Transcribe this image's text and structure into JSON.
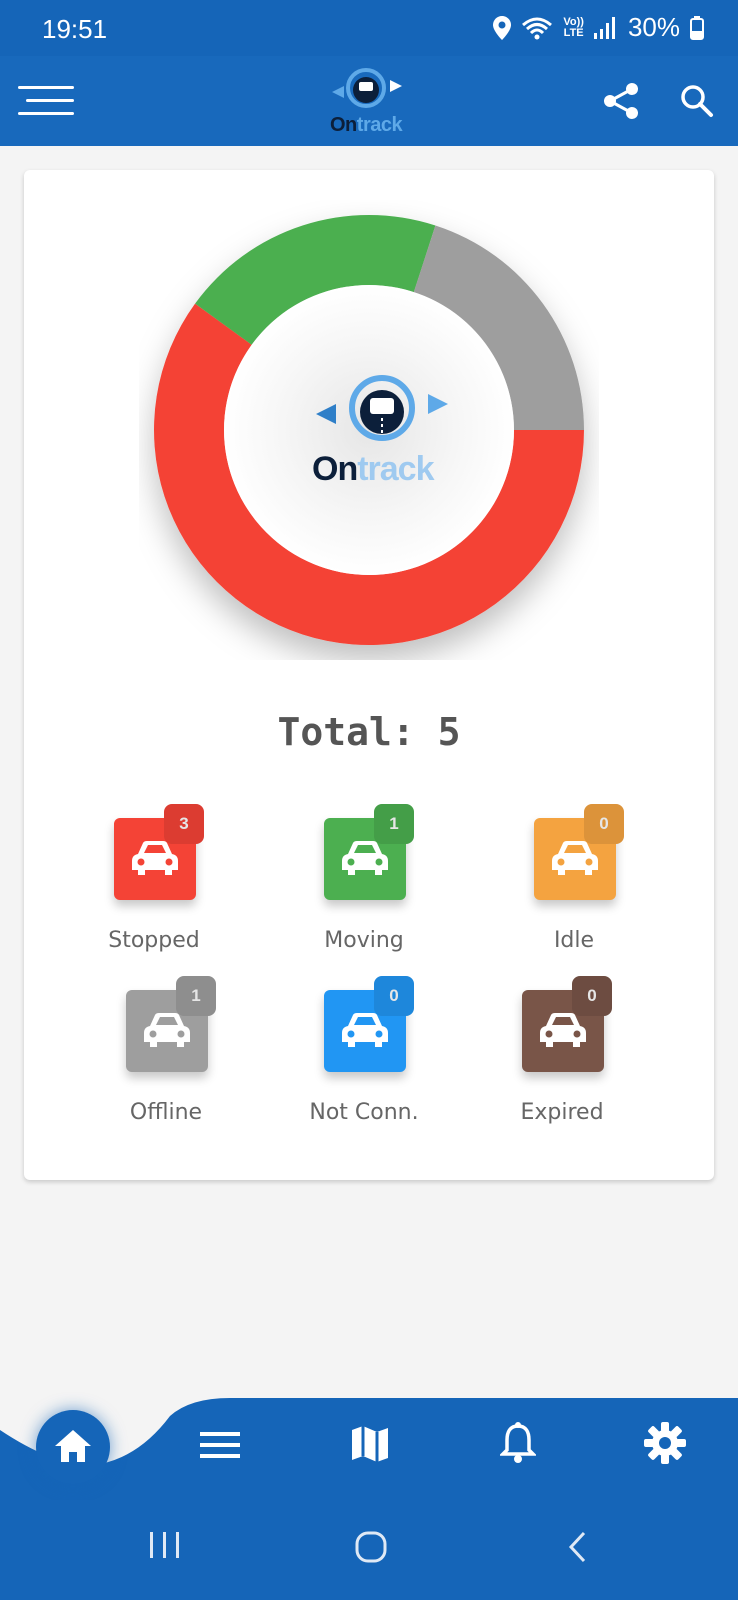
{
  "status_bar": {
    "time": "19:51",
    "network_top": "Vo))",
    "network_bottom": "LTE",
    "battery_percent": "30%"
  },
  "app_bar": {
    "logo_word_part1": "On",
    "logo_word_part2": "track",
    "colors": {
      "background": "#1869bc",
      "logo_dark": "#0c1f3a",
      "logo_light": "#5ea9e8"
    }
  },
  "dashboard": {
    "chart_data": {
      "type": "pie",
      "categories": [
        "Stopped",
        "Moving",
        "Idle",
        "Offline",
        "Not Conn.",
        "Expired"
      ],
      "values": [
        3,
        1,
        0,
        1,
        0,
        0
      ],
      "colors": [
        "#f44336",
        "#4caf50",
        "#f4a340",
        "#9e9e9e",
        "#2196f3",
        "#795548"
      ],
      "donut": true
    },
    "total_label": "Total:",
    "total_value": "5",
    "center_logo": {
      "word_part1": "On",
      "word_part2": "track"
    },
    "statuses": [
      {
        "label": "Stopped",
        "count": "3",
        "color": "#f44336"
      },
      {
        "label": "Moving",
        "count": "1",
        "color": "#4caf50"
      },
      {
        "label": "Idle",
        "count": "0",
        "color": "#f4a340"
      },
      {
        "label": "Offline",
        "count": "1",
        "color": "#9e9e9e"
      },
      {
        "label": "Not Conn.",
        "count": "0",
        "color": "#2196f3"
      },
      {
        "label": "Expired",
        "count": "0",
        "color": "#795548"
      }
    ]
  },
  "bottom_nav": {
    "items": [
      "home-icon",
      "list-icon",
      "map-icon",
      "bell-icon",
      "gear-icon"
    ],
    "color": "#1565b8"
  }
}
